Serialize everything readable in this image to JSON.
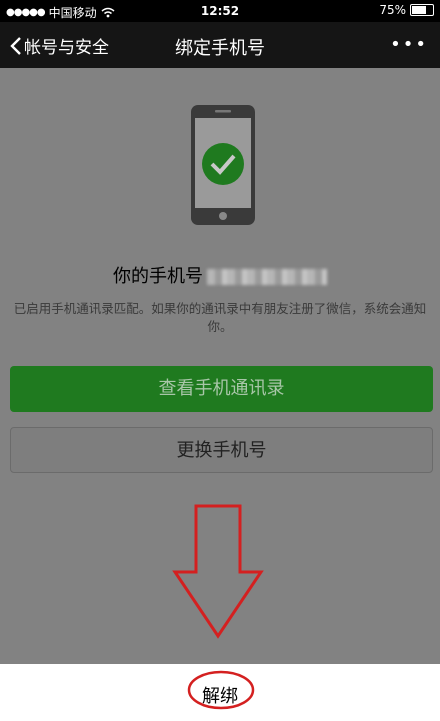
{
  "status_bar": {
    "signal_dots": "●●●●●",
    "carrier": "中国移动",
    "wifi_icon": "wifi-icon",
    "time": "12:52",
    "battery_percent": "75%",
    "battery_level": 0.75
  },
  "nav": {
    "back_label": "帐号与安全",
    "title": "绑定手机号",
    "more_label": "•••"
  },
  "profile": {
    "phone_label": "你的手机号"
  },
  "description": "已启用手机通讯录匹配。如果你的通讯录中有朋友注册了微信，系统会通知你。",
  "buttons": {
    "view_contacts": "查看手机通讯录",
    "change_number": "更换手机号",
    "unbind": "解绑"
  },
  "colors": {
    "green": "#1f7a1f",
    "annotation_red": "#d42020"
  }
}
